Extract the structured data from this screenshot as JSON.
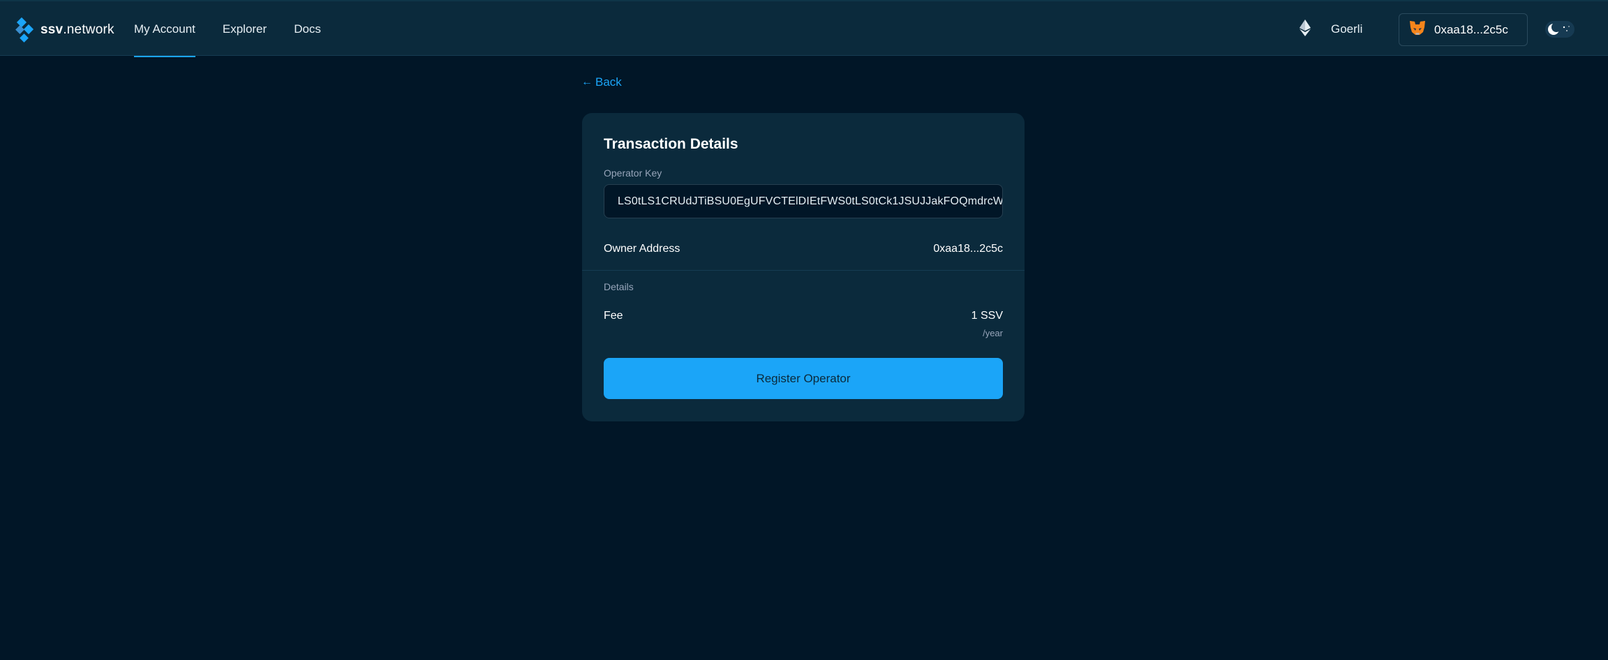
{
  "header": {
    "logo": {
      "bold": "ssv",
      "rest": ".network",
      "icon": "ssv-diamond-logo"
    },
    "nav": [
      {
        "label": "My Account",
        "active": true
      },
      {
        "label": "Explorer",
        "active": false
      },
      {
        "label": "Docs",
        "active": false
      }
    ],
    "network": {
      "icon": "ethereum-icon",
      "label": "Goerli"
    },
    "wallet": {
      "icon": "metamask-fox-icon",
      "label": "0xaa18...2c5c"
    },
    "theme_toggle": {
      "icon": "moon-icon"
    }
  },
  "back_link": {
    "icon": "arrow-left-icon",
    "icon_glyph": "←",
    "label": "Back"
  },
  "card": {
    "title": "Transaction Details",
    "operator_key_label": "Operator Key",
    "operator_key_value": "LS0tLS1CRUdJTiBSU0EgUFVCTElDIEtFWS0tLS0tCk1JSUJJakFOQmdrcW",
    "owner_address_label": "Owner Address",
    "owner_address_value": "0xaa18...2c5c",
    "details_label": "Details",
    "fee_label": "Fee",
    "fee_value": "1 SSV",
    "fee_period": "/year",
    "register_button_label": "Register Operator"
  },
  "colors": {
    "background": "#011627",
    "surface": "#0b2a3c",
    "accent": "#1ba5f8",
    "muted_text": "#97a5ba"
  }
}
